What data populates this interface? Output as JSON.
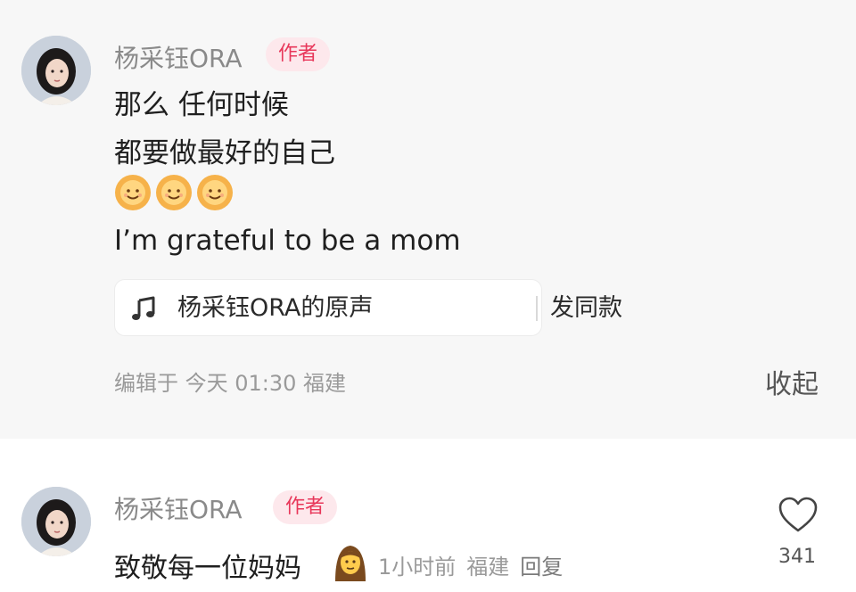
{
  "post": {
    "username": "杨采钰ORA",
    "author_badge": "作者",
    "lines": [
      "那么 任何时候",
      "都要做最好的自己",
      "I’m grateful to be a mom"
    ],
    "emoji_icons": [
      "smiling-sun-emoji",
      "smiling-sun-emoji",
      "smiling-sun-emoji"
    ],
    "music": {
      "icon": "music-note-icon",
      "sound_name": "杨采钰ORA的原声",
      "use_sound_label": "发同款"
    },
    "meta": "编辑于 今天 01:30 福建",
    "collapse_label": "收起"
  },
  "reply": {
    "username": "杨采钰ORA",
    "author_badge": "作者",
    "text": "致敬每一位妈妈",
    "emoji_icon": "woman-emoji",
    "time": "1小时前",
    "location": "福建",
    "reply_label": "回复",
    "like_icon": "heart-outline-icon",
    "like_count": "341"
  },
  "colors": {
    "post_background": "#f7f7f7",
    "badge_background": "#fde8ec",
    "badge_text": "#e8375a",
    "muted_text": "#9a9a9a"
  }
}
